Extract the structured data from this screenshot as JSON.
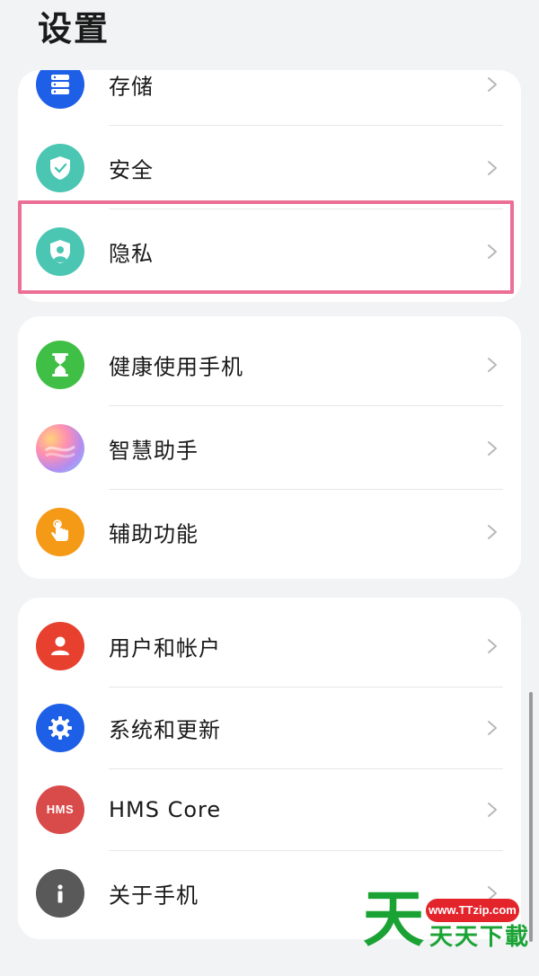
{
  "page_title": "设置",
  "groups": [
    {
      "items": [
        {
          "label": "存储",
          "icon": "storage-icon",
          "color": "#1e5fe8"
        },
        {
          "label": "安全",
          "icon": "shield-check-icon",
          "color": "#4bc6b3"
        },
        {
          "label": "隐私",
          "icon": "privacy-shield-icon",
          "color": "#4bc6b3"
        }
      ]
    },
    {
      "items": [
        {
          "label": "健康使用手机",
          "icon": "hourglass-icon",
          "color": "#3fbf45"
        },
        {
          "label": "智慧助手",
          "icon": "smart-assistant-icon",
          "color": "#b48cf0"
        },
        {
          "label": "辅助功能",
          "icon": "accessibility-hand-icon",
          "color": "#f59a17"
        }
      ]
    },
    {
      "items": [
        {
          "label": "用户和帐户",
          "icon": "user-icon",
          "color": "#e8402f"
        },
        {
          "label": "系统和更新",
          "icon": "gear-icon",
          "color": "#1e5fe8"
        },
        {
          "label": "HMS Core",
          "icon": "hms-icon",
          "color": "#d94a4a",
          "icon_text": "HMS"
        },
        {
          "label": "关于手机",
          "icon": "info-icon",
          "color": "#595959"
        }
      ]
    }
  ],
  "watermark": {
    "big_char": "天",
    "site": "www.TTzip.com",
    "brand": "天天下載"
  },
  "highlight_color": "#ec6f95"
}
